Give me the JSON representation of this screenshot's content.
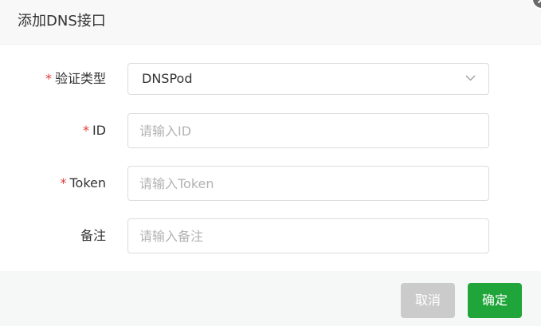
{
  "dialog": {
    "title": "添加DNS接口"
  },
  "form": {
    "required_mark": "*",
    "verify_type": {
      "label": "验证类型",
      "value": "DNSPod"
    },
    "id": {
      "label": "ID",
      "placeholder": "请输入ID",
      "value": ""
    },
    "token": {
      "label": "Token",
      "placeholder": "请输入Token",
      "value": ""
    },
    "remark": {
      "label": "备注",
      "placeholder": "请输入备注",
      "value": ""
    }
  },
  "footer": {
    "cancel_label": "取消",
    "confirm_label": "确定"
  },
  "colors": {
    "confirm": "#20a53a",
    "cancel": "#cbcbcb",
    "required": "#e53935"
  }
}
